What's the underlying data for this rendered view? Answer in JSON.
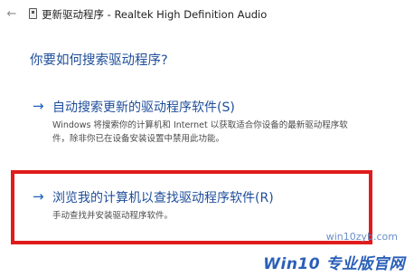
{
  "window": {
    "title": "更新驱动程序 - Realtek High Definition Audio",
    "back_icon": "back-arrow-icon",
    "device_icon": "device-icon"
  },
  "main": {
    "question": "你要如何搜索驱动程序?",
    "options": [
      {
        "arrow": "→",
        "title": "自动搜索更新的驱动程序软件(S)",
        "desc_line1": "Windows 将搜索你的计算机和 Internet 以获取适合你设备的最新驱动程序软",
        "desc_line2": "件，除非你已在设备安装设置中禁用此功能。"
      },
      {
        "arrow": "→",
        "title": "浏览我的计算机以查找驱动程序软件(R)",
        "desc_line1": "手动查找并安装驱动程序软件。"
      }
    ]
  },
  "watermark": {
    "url": "win10zyb.com",
    "logo": "Win10 专业版官网"
  },
  "colors": {
    "accent": "#1f4e9a",
    "highlight": "#e01b1b"
  }
}
